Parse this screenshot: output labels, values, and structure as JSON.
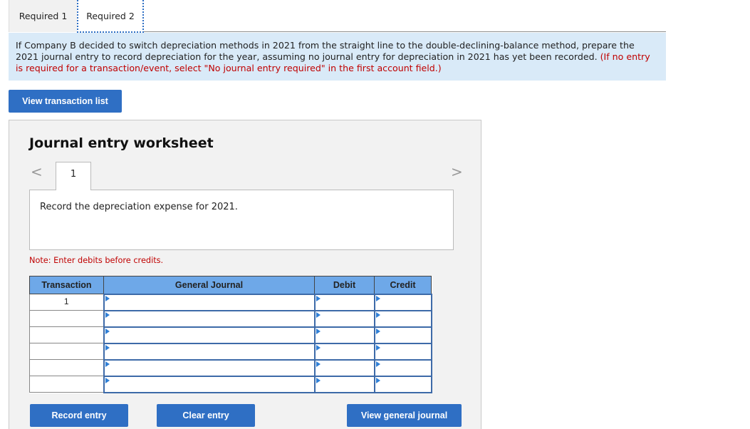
{
  "tabs": [
    {
      "label": "Required 1",
      "active": false
    },
    {
      "label": "Required 2",
      "active": true
    }
  ],
  "instruction": {
    "text": "If Company B decided to switch depreciation methods in 2021 from the straight line to the double-declining-balance method, prepare the 2021 journal entry to record depreciation for the year, assuming no journal entry for depreciation in 2021 has yet been recorded. ",
    "note": "(If no entry is required for a transaction/event, select \"No journal entry required\" in the first account field.)"
  },
  "buttons": {
    "view_transaction_list": "View transaction list",
    "record_entry": "Record entry",
    "clear_entry": "Clear entry",
    "view_general_journal": "View general journal"
  },
  "worksheet": {
    "title": "Journal entry worksheet",
    "prev_icon": "chevron-left-icon",
    "next_icon": "chevron-right-icon",
    "prev_glyph": "<",
    "next_glyph": ">",
    "current_page": "1",
    "description": "Record the depreciation expense for 2021.",
    "note": "Note: Enter debits before credits."
  },
  "table": {
    "headers": [
      "Transaction",
      "General Journal",
      "Debit",
      "Credit"
    ],
    "rows": [
      {
        "transaction": "1",
        "account": "",
        "debit": "",
        "credit": ""
      },
      {
        "transaction": "",
        "account": "",
        "debit": "",
        "credit": ""
      },
      {
        "transaction": "",
        "account": "",
        "debit": "",
        "credit": ""
      },
      {
        "transaction": "",
        "account": "",
        "debit": "",
        "credit": ""
      },
      {
        "transaction": "",
        "account": "",
        "debit": "",
        "credit": ""
      },
      {
        "transaction": "",
        "account": "",
        "debit": "",
        "credit": ""
      }
    ]
  },
  "colors": {
    "accent": "#2f6fc4",
    "header_blue": "#6ea8e8",
    "instruction_bg": "#d9eaf8",
    "note_red": "#c00000"
  }
}
